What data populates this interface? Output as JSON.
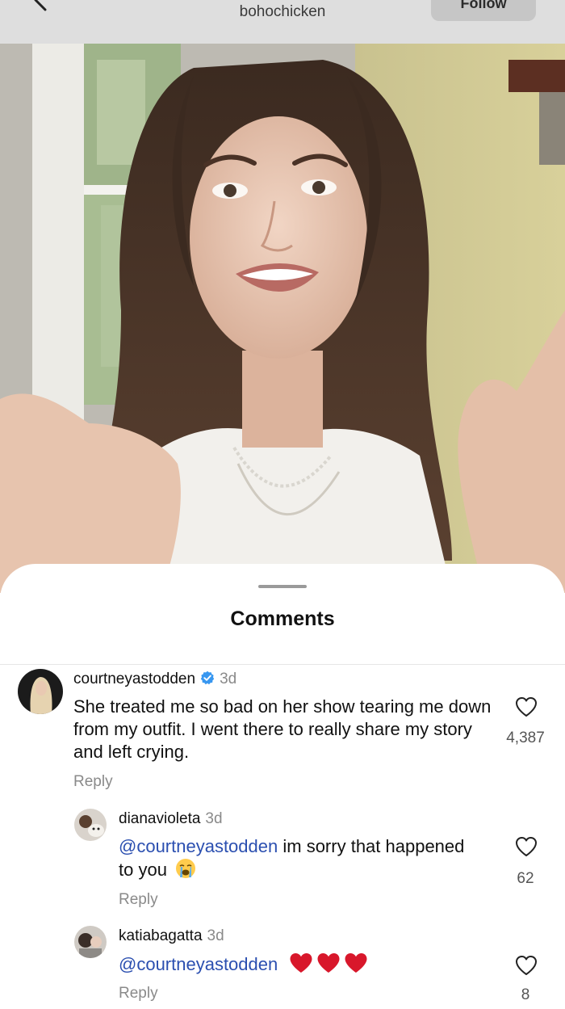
{
  "header": {
    "username": "bohochicken",
    "follow_label": "Follow"
  },
  "sheet": {
    "title": "Comments"
  },
  "comments": [
    {
      "username": "courtneyastodden",
      "verified": true,
      "time": "3d",
      "text": "She treated me so bad on her show tearing me down from my outfit. I went there to really share my story and left crying.",
      "likes": "4,387",
      "reply_label": "Reply"
    },
    {
      "username": "dianavioleta",
      "time": "3d",
      "mention": "@courtneyastodden",
      "text": "im sorry that happened to you",
      "emoji": "loudly-crying-face",
      "likes": "62",
      "reply_label": "Reply"
    },
    {
      "username": "katiabagatta",
      "time": "3d",
      "mention": "@courtneyastodden",
      "emoji": "red-heart x3",
      "likes": "8",
      "reply_label": "Reply"
    }
  ],
  "icons": {
    "back": "chevron-left-icon",
    "verified": "verified-badge-icon",
    "like": "heart-outline-icon"
  },
  "colors": {
    "mention": "#2b4fb0",
    "verified": "#3897f0",
    "heart": "#d8172b"
  }
}
